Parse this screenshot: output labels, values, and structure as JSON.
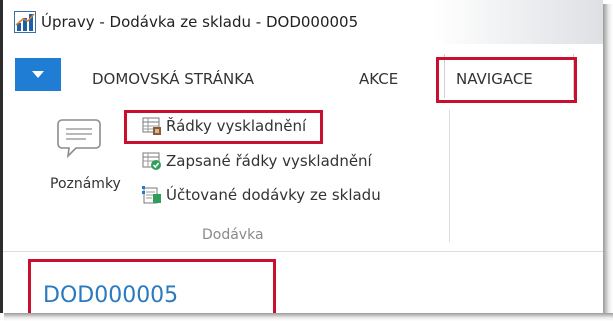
{
  "window": {
    "title": "Úpravy - Dodávka ze skladu - DOD000005",
    "app_icon": "chart-icon"
  },
  "ribbon": {
    "menu_button_icon": "menu-dropdown-icon",
    "tabs": [
      {
        "label": "DOMOVSKÁ STRÁNKA"
      },
      {
        "label": "AKCE"
      },
      {
        "label": "NAVIGACE",
        "selected": true
      }
    ],
    "groups": [
      {
        "label": "Dodávka",
        "notes_button": {
          "label": "Poznámky",
          "icon": "notes-icon"
        },
        "commands": [
          {
            "label": "Řádky vyskladnění",
            "icon": "lines-icon"
          },
          {
            "label": "Zapsané řádky vyskladnění",
            "icon": "registered-lines-icon"
          },
          {
            "label": "Účtované dodávky ze skladu",
            "icon": "posted-shipments-icon"
          }
        ]
      }
    ]
  },
  "document": {
    "number": "DOD000005"
  },
  "colors": {
    "accent": "#1f7ed4",
    "highlight": "#c8102e",
    "document_number": "#2a7ac0"
  }
}
